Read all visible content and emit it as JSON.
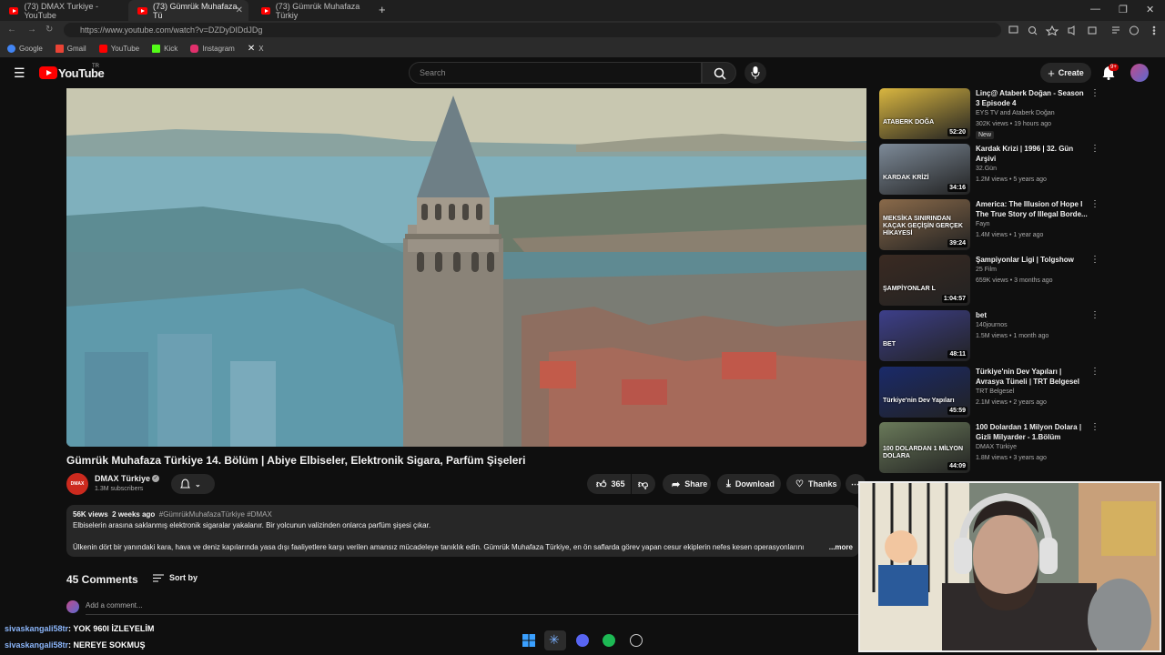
{
  "tabs": [
    {
      "label": "(73) DMAX Turkiye - YouTube"
    },
    {
      "label": "(73) Gümrük Muhafaza Tü"
    },
    {
      "label": "(73) Gümrük Muhafaza Türkiy"
    }
  ],
  "address": {
    "url": "https://www.youtube.com/watch?v=DZDyDIDdJDg"
  },
  "bookmarks": [
    {
      "label": "Google",
      "color": "#4285f4"
    },
    {
      "label": "Gmail",
      "color": "#ea4335"
    },
    {
      "label": "YouTube",
      "color": "#ff0000"
    },
    {
      "label": "Kick",
      "color": "#53fc18"
    },
    {
      "label": "Instagram",
      "color": "#e1306c"
    },
    {
      "label": "X",
      "color": "#ffffff"
    }
  ],
  "header": {
    "logo": "YouTube",
    "region": "TR",
    "search_placeholder": "Search",
    "create_label": "Create",
    "notif_badge": "9+"
  },
  "video": {
    "title": "Gümrük Muhafaza Türkiye 14. Bölüm | Abiye Elbiseler, Elektronik Sigara, Parfüm Şişeleri",
    "channel": "DMAX Türkiye",
    "channel_avatar_text": "DMAX",
    "subscribers": "1.3M subscribers",
    "likes": "365",
    "share_label": "Share",
    "download_label": "Download",
    "thanks_label": "Thanks"
  },
  "description": {
    "views": "56K views",
    "age": "2 weeks ago",
    "tags": "#GümrükMuhafazaTürkiye #DMAX",
    "line1": "Elbiselerin arasına saklanmış elektronik sigaralar yakalanır. Bir yolcunun valizinden onlarca parfüm şişesi çıkar.",
    "line2": "Ülkenin dört bir yanındaki kara, hava ve deniz kapılarında yasa dışı faaliyetlere karşı verilen amansız mücadeleye tanıklık edin. Gümrük Muhafaza Türkiye, en ön saflarda görev yapan cesur ekiplerin nefes kesen operasyonlarını",
    "more": "...more"
  },
  "comments": {
    "count": "45 Comments",
    "sort_label": "Sort by",
    "add_placeholder": "Add a comment..."
  },
  "recommendations": [
    {
      "title": "Linç@ Ataberk Doğan - Season 3 Episode 4",
      "channel": "EYS TV and Ataberk Doğan",
      "meta": "302K views • 19 hours ago",
      "badge": "New",
      "duration": "52:20",
      "thumb": "#d9b640"
    },
    {
      "title": "Kardak Krizi | 1996 | 32. Gün Arşivi",
      "channel": "32.Gün",
      "meta": "1.2M views • 5 years ago",
      "badge": "",
      "duration": "34:16",
      "thumb": "#7d8a98"
    },
    {
      "title": "America: The Illusion of Hope I The True Story of Illegal Borde...",
      "channel": "Fayn",
      "meta": "1.4M views • 1 year ago",
      "badge": "",
      "duration": "39:24",
      "thumb": "#8a6a4a"
    },
    {
      "title": "Şampiyonlar Ligi | Tolgshow",
      "channel": "25 Film",
      "meta": "659K views • 3 months ago",
      "badge": "",
      "duration": "1:04:57",
      "thumb": "#3a2a22"
    },
    {
      "title": "bet",
      "channel": "140journos",
      "meta": "1.5M views • 1 month ago",
      "badge": "",
      "duration": "48:11",
      "thumb": "#3d3f8a"
    },
    {
      "title": "Türkiye'nin Dev Yapıları | Avrasya Tüneli | TRT Belgesel",
      "channel": "TRT Belgesel",
      "meta": "2.1M views • 2 years ago",
      "badge": "",
      "duration": "45:59",
      "thumb": "#1a2a6a"
    },
    {
      "title": "100 Dolardan 1 Milyon Dolara | Gizli Milyarder - 1.Bölüm",
      "channel": "DMAX Türkiye",
      "meta": "1.8M views • 3 years ago",
      "badge": "",
      "duration": "44:09",
      "thumb": "#6a7a5a"
    }
  ],
  "recommendation_thumb_texts": [
    "ATABERK DOĞA",
    "KARDAK KRİZİ",
    "MEKSİKA SINIRINDAN KAÇAK GEÇİŞİN GERÇEK HİKAYESİ",
    "ŞAMPİYONLAR L",
    "BET",
    "Türkiye'nin Dev Yapıları",
    "100 DOLARDAN 1 MİLYON DOLARA"
  ],
  "chat": [
    {
      "user": "sivaskangali58tr",
      "message": ": YOK 960I İZLEYELİM"
    },
    {
      "user": "sivaskangali58tr",
      "message": ": NEREYE SOKMUŞ"
    }
  ]
}
